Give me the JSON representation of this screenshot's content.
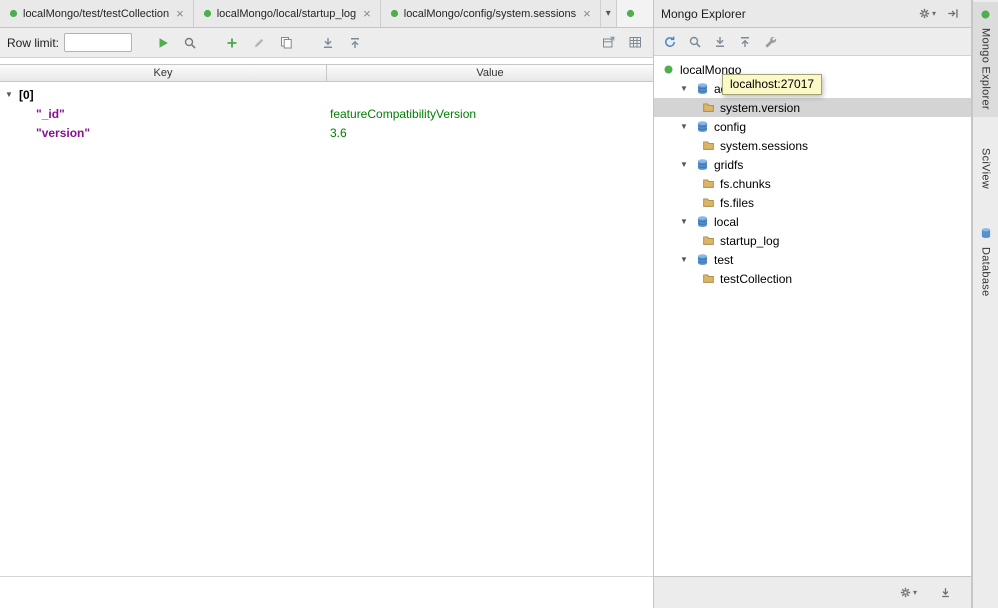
{
  "glyphs": {
    "expanded": "▼",
    "chevron_down": "▾",
    "close": "×"
  },
  "colors": {
    "key_text": "#871094",
    "value_text": "#008000",
    "selection": "#d4d4d4",
    "tooltip_bg": "#fbf9c6",
    "run_green": "#4fae4e",
    "database_blue": "#5591cf",
    "folder_tan": "#ddb567"
  },
  "tabs": {
    "items": [
      {
        "label": "localMongo/test/testCollection"
      },
      {
        "label": "localMongo/local/startup_log"
      },
      {
        "label": "localMongo/config/system.sessions"
      }
    ],
    "overflow_chevron": "▾"
  },
  "editor": {
    "toolbar": {
      "row_limit_label": "Row limit:",
      "row_limit_value": "",
      "icons": [
        "run-icon",
        "explain-query-icon",
        "add-document-icon",
        "edit-document-icon",
        "copy-document-icon",
        "expand-all-icon",
        "collapse-all-icon",
        "open-in-editor-icon",
        "view-as-table-icon"
      ]
    },
    "table": {
      "columns": [
        "Key",
        "Value"
      ],
      "rows": [
        {
          "key": "[0]",
          "value": "",
          "style": "index",
          "indent": 0,
          "chevron": true
        },
        {
          "key": "\"_id\"",
          "value": "featureCompatibilityVersion",
          "style": "name",
          "indent": 1,
          "chevron": false
        },
        {
          "key": "\"version\"",
          "value": "3.6",
          "style": "name",
          "indent": 1,
          "chevron": false
        }
      ]
    }
  },
  "explorer": {
    "title": "Mongo Explorer",
    "toolbar_icons": [
      "refresh-icon",
      "find-icon",
      "expand-all-icon",
      "collapse-all-icon",
      "settings-wrench-icon"
    ],
    "tree": [
      {
        "label": "localMongo",
        "level": 0,
        "icon": "server",
        "chevron": false,
        "selected": false
      },
      {
        "label": "admin",
        "level": 1,
        "icon": "database",
        "chevron": true,
        "selected": false
      },
      {
        "label": "system.version",
        "level": 2,
        "icon": "collection",
        "chevron": false,
        "selected": true
      },
      {
        "label": "config",
        "level": 1,
        "icon": "database",
        "chevron": true,
        "selected": false
      },
      {
        "label": "system.sessions",
        "level": 2,
        "icon": "collection",
        "chevron": false,
        "selected": false
      },
      {
        "label": "gridfs",
        "level": 1,
        "icon": "database",
        "chevron": true,
        "selected": false
      },
      {
        "label": "fs.chunks",
        "level": 2,
        "icon": "collection",
        "chevron": false,
        "selected": false
      },
      {
        "label": "fs.files",
        "level": 2,
        "icon": "collection",
        "chevron": false,
        "selected": false
      },
      {
        "label": "local",
        "level": 1,
        "icon": "database",
        "chevron": true,
        "selected": false
      },
      {
        "label": "startup_log",
        "level": 2,
        "icon": "collection",
        "chevron": false,
        "selected": false
      },
      {
        "label": "test",
        "level": 1,
        "icon": "database",
        "chevron": true,
        "selected": false
      },
      {
        "label": "testCollection",
        "level": 2,
        "icon": "collection",
        "chevron": false,
        "selected": false
      }
    ]
  },
  "tooltip": {
    "text": "localhost:27017"
  },
  "right_stripe": {
    "items": [
      {
        "label": "Mongo Explorer",
        "active": true
      },
      {
        "label": "SciView",
        "active": false
      },
      {
        "label": "Database",
        "active": false
      }
    ]
  }
}
